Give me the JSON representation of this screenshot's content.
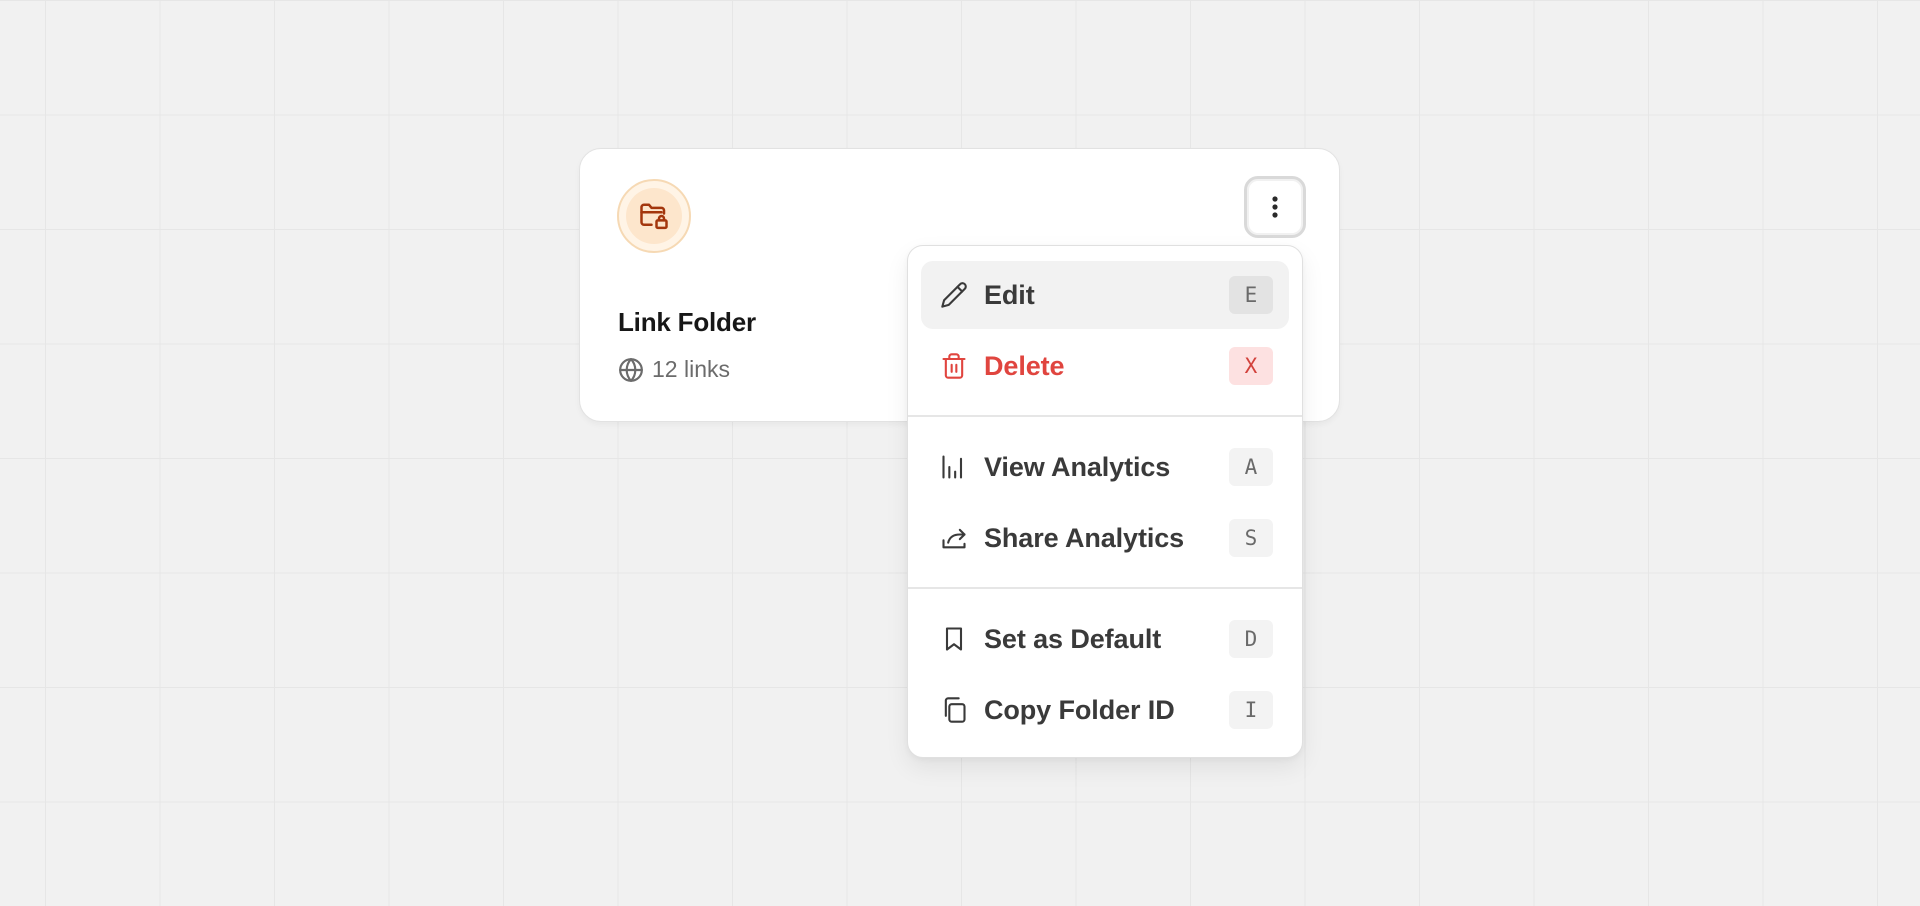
{
  "card": {
    "title": "Link Folder",
    "links_count": "12 links",
    "icons": {
      "folder": "folder-lock-icon",
      "globe": "globe-icon",
      "more": "more-vertical-icon"
    },
    "accent_color": "#c2410c"
  },
  "menu": {
    "items": [
      {
        "label": "Edit",
        "shortcut": "E",
        "icon": "pencil-icon",
        "state": "highlighted"
      },
      {
        "label": "Delete",
        "shortcut": "X",
        "icon": "trash-icon",
        "state": "danger",
        "color": "#e0453f"
      },
      {
        "label": "View Analytics",
        "shortcut": "A",
        "icon": "bar-chart-icon"
      },
      {
        "label": "Share Analytics",
        "shortcut": "S",
        "icon": "share-icon"
      },
      {
        "label": "Set as Default",
        "shortcut": "D",
        "icon": "bookmark-icon"
      },
      {
        "label": "Copy Folder ID",
        "shortcut": "I",
        "icon": "copy-icon"
      }
    ]
  }
}
